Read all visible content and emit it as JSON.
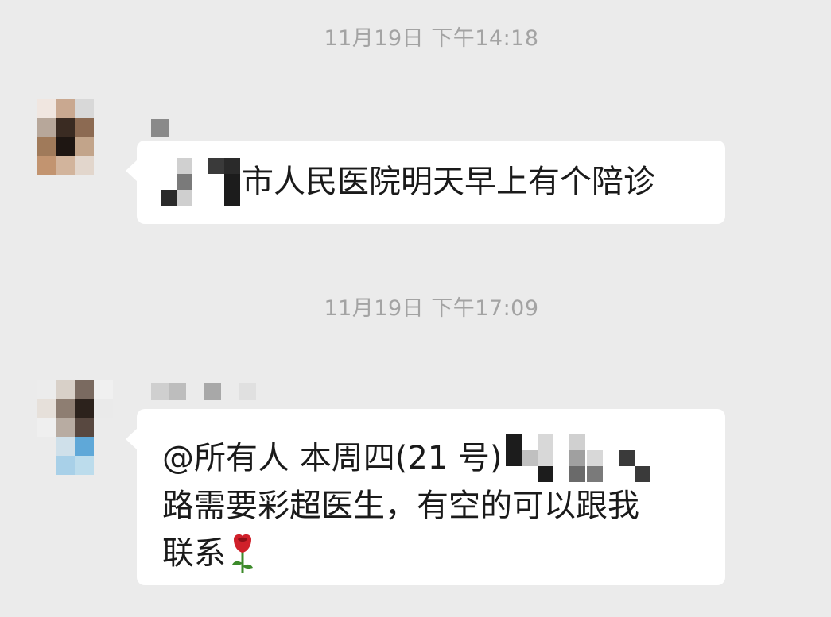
{
  "chat": {
    "messages": [
      {
        "timestamp": "11月19日 下午14:18",
        "text_visible": "市人民医院明天早上有个陪诊",
        "avatar_icon": "pixelated-avatar-icon"
      },
      {
        "timestamp": "11月19日 下午17:09",
        "line1_prefix": "@所有人  本周四(21 号)",
        "line2": "路需要彩超医生，有空的可以跟我",
        "line3": "联系",
        "emoji": "rose-emoji-icon",
        "avatar_icon": "pixelated-avatar-icon"
      }
    ]
  },
  "colors": {
    "background": "#ebebeb",
    "bubble": "#ffffff",
    "timestamp": "#a3a3a3",
    "text": "#1a1a1a"
  }
}
